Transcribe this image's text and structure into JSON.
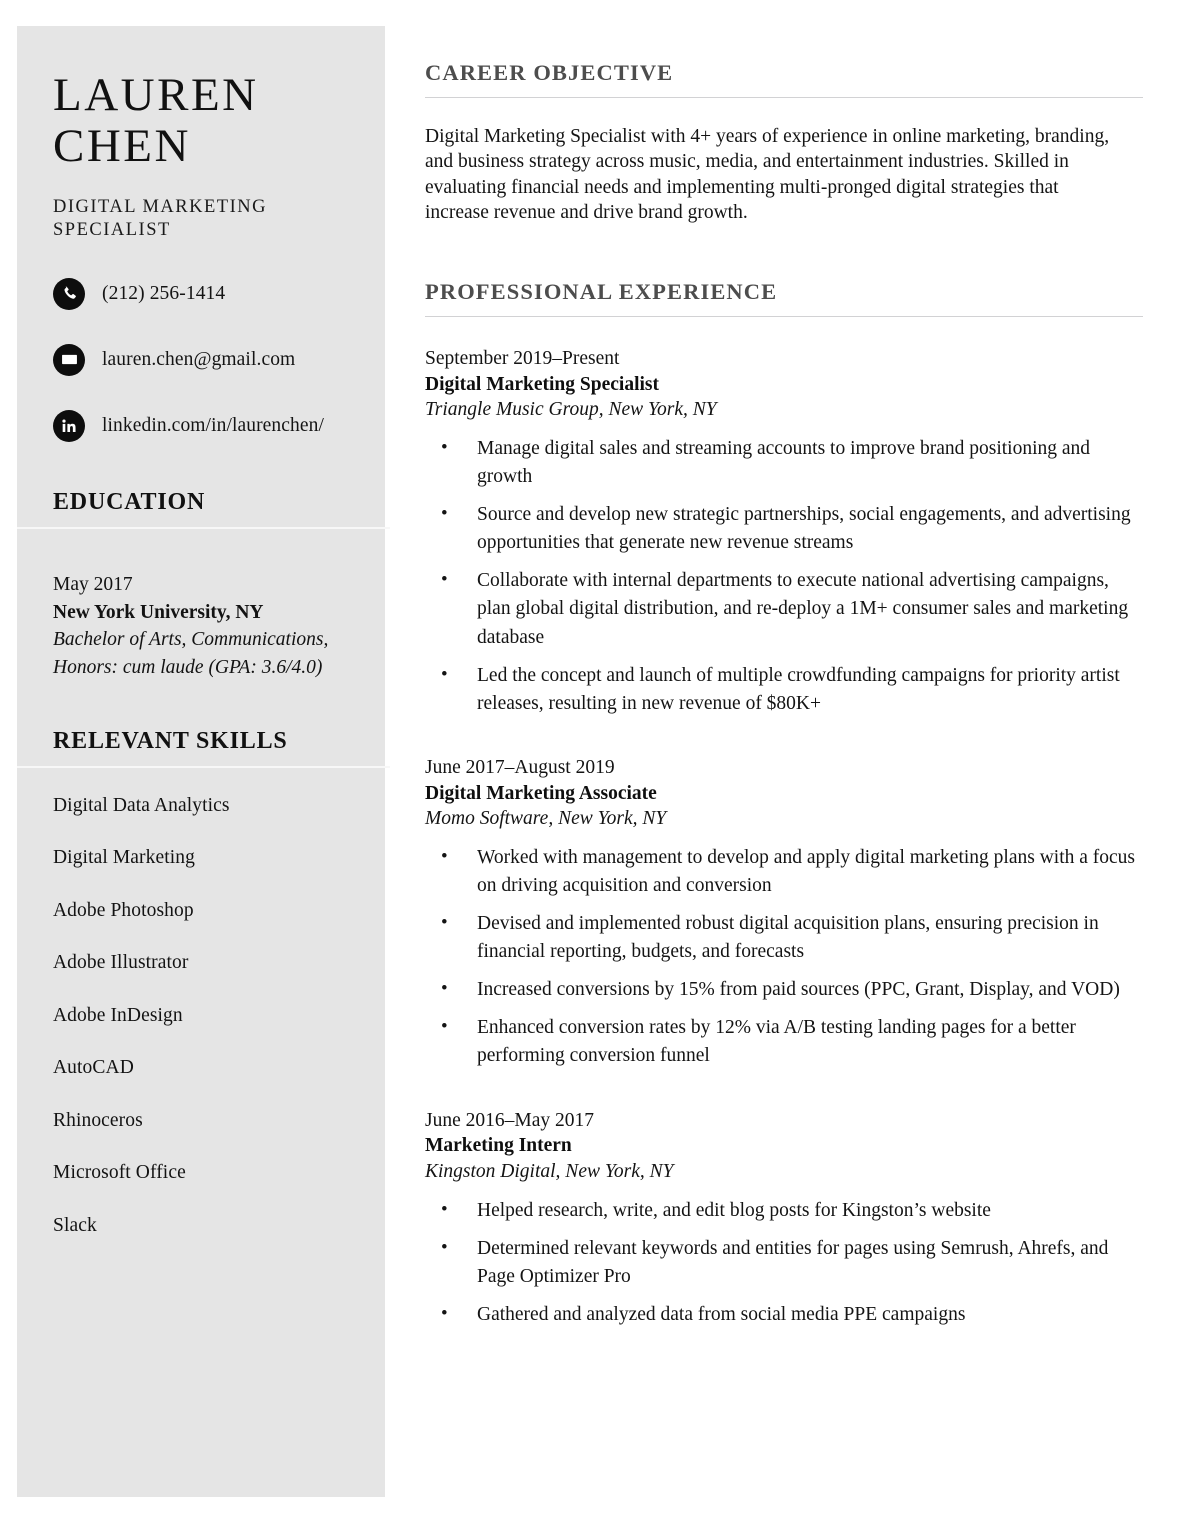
{
  "colors": {
    "sidebar_bg": "#e5e5e5",
    "page_bg": "#ffffff",
    "icon_bg": "#0d0d0d",
    "heading_gray": "#4d4d4d",
    "rule_gray": "#d2d2d4",
    "text": "#141414"
  },
  "sidebar": {
    "name_line1": "LAUREN",
    "name_line2": "CHEN",
    "role": "DIGITAL MARKETING SPECIALIST",
    "contacts": [
      {
        "icon": "phone-icon",
        "text": "(212) 256-1414"
      },
      {
        "icon": "envelope-icon",
        "text": "lauren.chen@gmail.com"
      },
      {
        "icon": "linkedin-icon",
        "text": "linkedin.com/in/laurenchen/"
      }
    ],
    "education": {
      "heading": "EDUCATION",
      "date": "May 2017",
      "school": "New York University, NY",
      "degree_line1": "Bachelor of Arts, Communications,",
      "degree_line2": "Honors: cum laude (GPA: 3.6/4.0)"
    },
    "skills": {
      "heading": "RELEVANT SKILLS",
      "items": [
        "Digital Data Analytics",
        "Digital Marketing",
        "Adobe Photoshop",
        "Adobe Illustrator",
        "Adobe InDesign",
        "AutoCAD",
        "Rhinoceros",
        "Microsoft Office",
        "Slack"
      ]
    }
  },
  "main": {
    "objective": {
      "heading": "CAREER OBJECTIVE",
      "text": "Digital Marketing Specialist with 4+ years of experience in online marketing, branding, and business strategy across music, media, and entertainment industries. Skilled in evaluating financial needs and implementing multi-pronged digital strategies that increase revenue and drive brand growth."
    },
    "experience": {
      "heading": "PROFESSIONAL EXPERIENCE",
      "jobs": [
        {
          "date": "September 2019–Present",
          "title": "Digital Marketing Specialist",
          "org": "Triangle Music Group, New York, NY",
          "bullets": [
            "Manage digital sales and streaming accounts to improve brand positioning and growth",
            "Source and develop new strategic partnerships, social engagements, and advertising opportunities that generate new revenue streams",
            "Collaborate with internal departments to execute national advertising campaigns, plan global digital distribution, and re-deploy a 1M+ consumer sales and marketing database",
            "Led the concept and launch of multiple crowdfunding campaigns for priority artist releases, resulting in new revenue of $80K+"
          ]
        },
        {
          "date": "June 2017–August 2019",
          "title": "Digital Marketing Associate",
          "org": "Momo Software, New York, NY",
          "bullets": [
            "Worked with management to develop and apply digital marketing plans with a focus on driving acquisition and conversion",
            "Devised and implemented robust digital acquisition plans, ensuring precision in financial reporting, budgets, and forecasts",
            "Increased conversions by 15% from paid sources (PPC, Grant, Display, and VOD)",
            "Enhanced conversion rates by 12% via A/B testing landing pages for a better performing conversion funnel"
          ]
        },
        {
          "date": "June 2016–May 2017",
          "title": "Marketing Intern",
          "org": "Kingston Digital, New York, NY",
          "bullets": [
            "Helped research, write, and edit blog posts for Kingston’s website",
            "Determined relevant keywords and entities for pages using Semrush, Ahrefs, and Page Optimizer Pro",
            "Gathered and analyzed data from social media PPE campaigns"
          ]
        }
      ]
    }
  }
}
